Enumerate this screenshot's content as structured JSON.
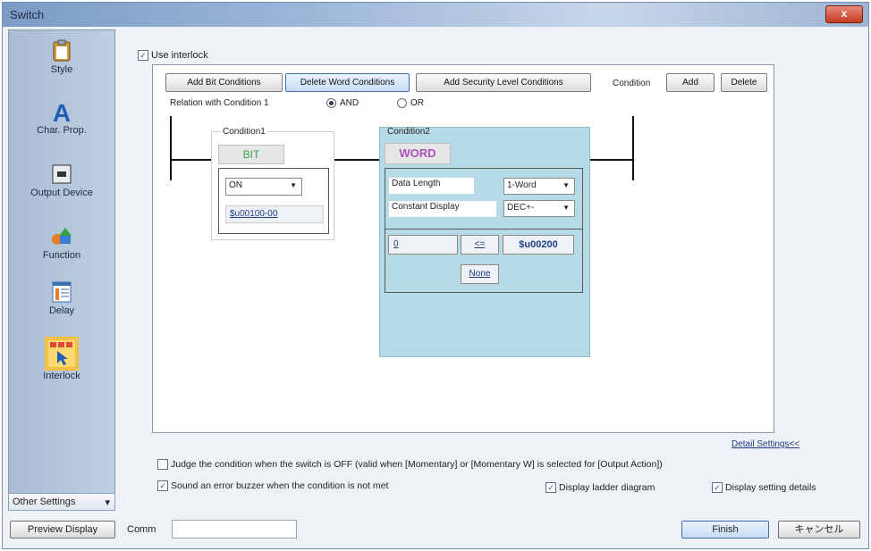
{
  "window": {
    "title": "Switch",
    "close_label": "x"
  },
  "sidebar": {
    "items": [
      {
        "label": "Style",
        "icon": "clipboard-style-icon"
      },
      {
        "label": "Char. Prop.",
        "icon": "letter-a-icon"
      },
      {
        "label": "Output Device",
        "icon": "output-device-icon"
      },
      {
        "label": "Function",
        "icon": "function-shapes-icon"
      },
      {
        "label": "Delay",
        "icon": "delay-list-icon"
      },
      {
        "label": "Interlock",
        "icon": "interlock-icon",
        "selected": true
      }
    ],
    "other_settings": {
      "label": "Other Settings",
      "arrow": "▾"
    }
  },
  "interlock": {
    "use_label": "Use interlock",
    "use_checked": true
  },
  "toolbar": {
    "add_bit": "Add Bit Conditions",
    "delete_word": "Delete Word Conditions",
    "add_security": "Add Security Level Conditions",
    "condition_label": "Condition",
    "add": "Add",
    "delete": "Delete"
  },
  "relation": {
    "label": "Relation with Condition 1",
    "and": "AND",
    "or": "OR",
    "selected": "AND"
  },
  "condition1": {
    "title": "Condition1",
    "type": "BIT",
    "state": "ON",
    "device": "$u00100-00"
  },
  "condition2": {
    "title": "Condition2",
    "type": "WORD",
    "data_length_label": "Data Length",
    "data_length_value": "1-Word",
    "constant_display_label": "Constant Display",
    "constant_display_value": "DEC+-",
    "constant_value": "0",
    "operator": "<=",
    "device": "$u00200",
    "none_label": "None"
  },
  "detail_link": "Detail Settings<<",
  "options": {
    "judge_off": {
      "label": "Judge the condition when the switch is OFF (valid when [Momentary] or [Momentary W] is selected for [Output Action])",
      "checked": false
    },
    "sound_error": {
      "label": "Sound an error buzzer when the condition is not met",
      "checked": true
    },
    "ladder": {
      "label": "Display ladder diagram",
      "checked": true
    },
    "setting_details": {
      "label": "Display setting details",
      "checked": true
    }
  },
  "footer": {
    "preview": "Preview Display",
    "comment_label": "Comm",
    "comment_value": "",
    "finish": "Finish",
    "cancel": "キャンセル"
  },
  "colors": {
    "accent": "#3d6fb5",
    "word_panel": "#b7dbe6",
    "bit_label": "#3aa34a",
    "word_label": "#b14fbf"
  }
}
